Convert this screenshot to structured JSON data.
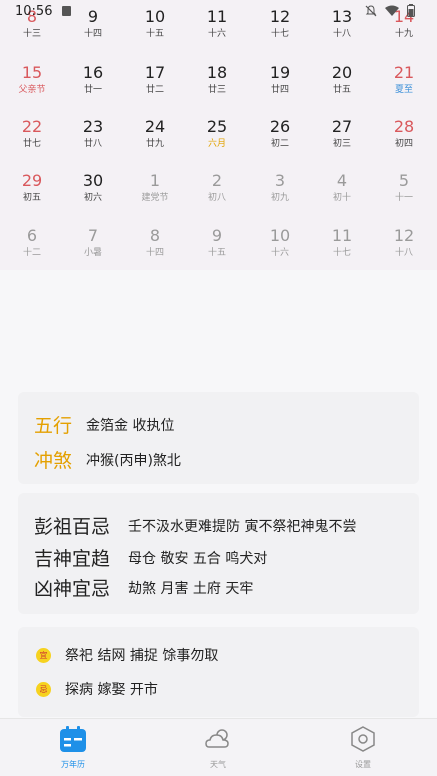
{
  "status_bar": {
    "time": "10:56"
  },
  "calendar": {
    "rows": [
      [
        {
          "num": "8",
          "sub": "十三",
          "kind": "weekend"
        },
        {
          "num": "9",
          "sub": "十四",
          "kind": ""
        },
        {
          "num": "10",
          "sub": "十五",
          "kind": ""
        },
        {
          "num": "11",
          "sub": "十六",
          "kind": ""
        },
        {
          "num": "12",
          "sub": "十七",
          "kind": ""
        },
        {
          "num": "13",
          "sub": "十八",
          "kind": ""
        },
        {
          "num": "14",
          "sub": "十九",
          "kind": "weekend"
        }
      ],
      [
        {
          "num": "15",
          "sub": "父亲节",
          "kind": "weekend festival"
        },
        {
          "num": "16",
          "sub": "廿一",
          "kind": ""
        },
        {
          "num": "17",
          "sub": "廿二",
          "kind": ""
        },
        {
          "num": "18",
          "sub": "廿三",
          "kind": ""
        },
        {
          "num": "19",
          "sub": "廿四",
          "kind": ""
        },
        {
          "num": "20",
          "sub": "廿五",
          "kind": ""
        },
        {
          "num": "21",
          "sub": "夏至",
          "kind": "weekend solar"
        }
      ],
      [
        {
          "num": "22",
          "sub": "廿七",
          "kind": "weekend"
        },
        {
          "num": "23",
          "sub": "廿八",
          "kind": ""
        },
        {
          "num": "24",
          "sub": "廿九",
          "kind": ""
        },
        {
          "num": "25",
          "sub": "六月",
          "kind": "today"
        },
        {
          "num": "26",
          "sub": "初二",
          "kind": ""
        },
        {
          "num": "27",
          "sub": "初三",
          "kind": ""
        },
        {
          "num": "28",
          "sub": "初四",
          "kind": "weekend"
        }
      ],
      [
        {
          "num": "29",
          "sub": "初五",
          "kind": "weekend"
        },
        {
          "num": "30",
          "sub": "初六",
          "kind": ""
        },
        {
          "num": "1",
          "sub": "建党节",
          "kind": "other"
        },
        {
          "num": "2",
          "sub": "初八",
          "kind": "other"
        },
        {
          "num": "3",
          "sub": "初九",
          "kind": "other"
        },
        {
          "num": "4",
          "sub": "初十",
          "kind": "other"
        },
        {
          "num": "5",
          "sub": "十一",
          "kind": "other"
        }
      ],
      [
        {
          "num": "6",
          "sub": "十二",
          "kind": "other"
        },
        {
          "num": "7",
          "sub": "小暑",
          "kind": "other"
        },
        {
          "num": "8",
          "sub": "十四",
          "kind": "other"
        },
        {
          "num": "9",
          "sub": "十五",
          "kind": "other"
        },
        {
          "num": "10",
          "sub": "十六",
          "kind": "other"
        },
        {
          "num": "11",
          "sub": "十七",
          "kind": "other"
        },
        {
          "num": "12",
          "sub": "十八",
          "kind": "other"
        }
      ]
    ]
  },
  "wuxing": {
    "label": "五行",
    "value": "金箔金 收执位"
  },
  "chongsha": {
    "label": "冲煞",
    "value": "冲猴(丙申)煞北"
  },
  "pengzu": {
    "label": "彭祖百忌",
    "value": "壬不汲水更难提防 寅不祭祀神鬼不尝"
  },
  "jishen": {
    "label": "吉神宜趋",
    "value": "母仓 敬安 五合 鸣犬对"
  },
  "xiongshen": {
    "label": "凶神宜忌",
    "value": "劫煞 月害 土府 天牢"
  },
  "yi": {
    "badge": "宜",
    "value": "祭祀 结网 捕捉 馀事勿取"
  },
  "ji": {
    "badge": "忌",
    "value": "探病 嫁娶 开市"
  },
  "nav": {
    "calendar": "万年历",
    "weather": "天气",
    "settings": "设置"
  },
  "colors": {
    "accent": "#1e90e8",
    "weekend": "#d9585c",
    "gold": "#e4a000"
  }
}
